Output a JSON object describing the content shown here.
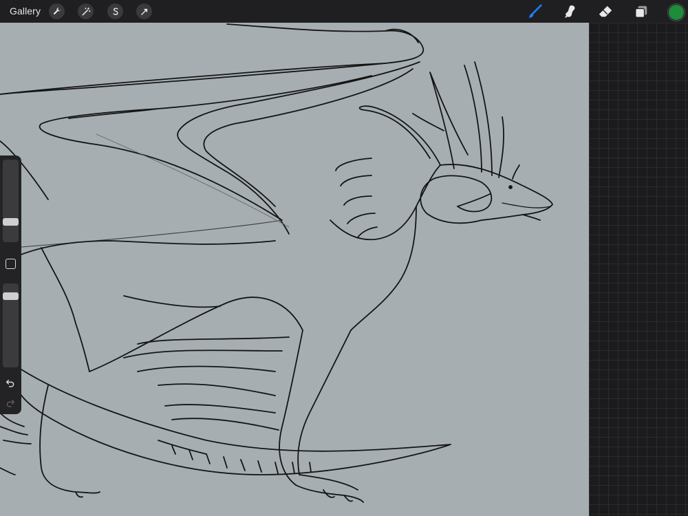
{
  "topbar": {
    "gallery_label": "Gallery",
    "left_tools": [
      {
        "name": "actions",
        "icon": "wrench-icon"
      },
      {
        "name": "adjustments",
        "icon": "magic-wand-icon"
      },
      {
        "name": "selection",
        "icon": "selection-s-icon"
      },
      {
        "name": "transform",
        "icon": "arrow-cursor-icon"
      }
    ],
    "right_tools": [
      {
        "name": "brush",
        "icon": "brush-icon",
        "active": true
      },
      {
        "name": "smudge",
        "icon": "smudge-icon"
      },
      {
        "name": "eraser",
        "icon": "eraser-icon"
      },
      {
        "name": "layers",
        "icon": "layers-icon"
      }
    ],
    "current_color": "#1e8c3a"
  },
  "sidebar": {
    "brush_size_level": 0.22,
    "opacity_level": 0.88,
    "modify_icon": "square-icon",
    "undo_icon": "undo-icon",
    "redo_icon": "redo-icon"
  },
  "colors": {
    "canvas": "#a6aeb1",
    "toolbar": "#1f1f21",
    "active_tool": "#1e7bff",
    "line": "#141414"
  }
}
